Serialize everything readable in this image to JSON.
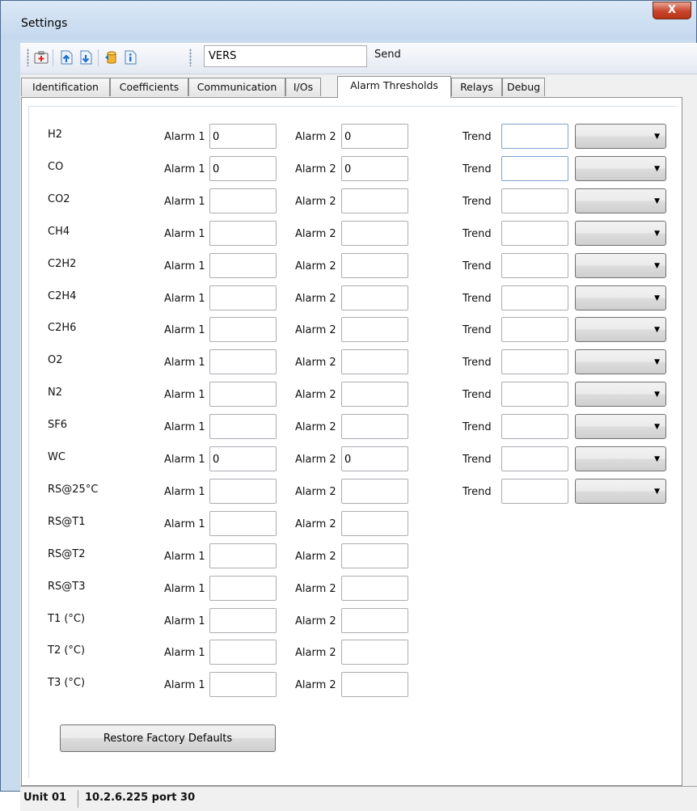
{
  "window": {
    "title": "Settings",
    "close_label": "X"
  },
  "toolbar": {
    "command_value": "VERS",
    "send_label": "Send",
    "icons": [
      "first-aid-icon",
      "upload-icon",
      "download-icon",
      "database-icon",
      "info-icon"
    ]
  },
  "tabs": [
    {
      "label": "Identification"
    },
    {
      "label": "Coefficients"
    },
    {
      "label": "Communication"
    },
    {
      "label": "I/Os"
    },
    {
      "label": "Alarm Thresholds",
      "active": true
    },
    {
      "label": "Relays"
    },
    {
      "label": "Debug"
    }
  ],
  "alarm_labels": {
    "alarm1": "Alarm 1",
    "alarm2": "Alarm 2",
    "trend": "Trend"
  },
  "rows": [
    {
      "name": "H2",
      "alarm1": "0",
      "alarm2": "0",
      "trend": ""
    },
    {
      "name": "CO",
      "alarm1": "0",
      "alarm2": "0",
      "trend": ""
    },
    {
      "name": "CO2",
      "alarm1": "",
      "alarm2": "",
      "trend": ""
    },
    {
      "name": "CH4",
      "alarm1": "",
      "alarm2": "",
      "trend": ""
    },
    {
      "name": "C2H2",
      "alarm1": "",
      "alarm2": "",
      "trend": ""
    },
    {
      "name": "C2H4",
      "alarm1": "",
      "alarm2": "",
      "trend": ""
    },
    {
      "name": "C2H6",
      "alarm1": "",
      "alarm2": "",
      "trend": ""
    },
    {
      "name": "O2",
      "alarm1": "",
      "alarm2": "",
      "trend": ""
    },
    {
      "name": "N2",
      "alarm1": "",
      "alarm2": "",
      "trend": ""
    },
    {
      "name": "SF6",
      "alarm1": "",
      "alarm2": "",
      "trend": ""
    },
    {
      "name": "WC",
      "alarm1": "0",
      "alarm2": "0",
      "trend": ""
    },
    {
      "name": "RS@25°C",
      "alarm1": "",
      "alarm2": "",
      "trend": ""
    },
    {
      "name": "RS@T1",
      "alarm1": "",
      "alarm2": ""
    },
    {
      "name": "RS@T2",
      "alarm1": "",
      "alarm2": ""
    },
    {
      "name": "RS@T3",
      "alarm1": "",
      "alarm2": ""
    },
    {
      "name": "T1 (°C)",
      "alarm1": "",
      "alarm2": ""
    },
    {
      "name": "T2 (°C)",
      "alarm1": "",
      "alarm2": ""
    },
    {
      "name": "T3 (°C)",
      "alarm1": "",
      "alarm2": ""
    }
  ],
  "restore_label": "Restore Factory Defaults",
  "status": {
    "unit": "Unit 01",
    "address": "10.2.6.225 port 30"
  }
}
